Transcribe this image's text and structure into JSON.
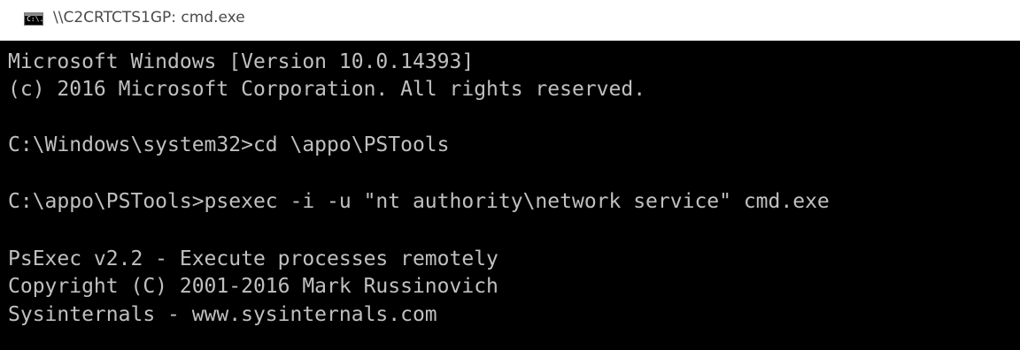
{
  "window": {
    "title": "\\\\C2CRTCTS1GP: cmd.exe",
    "icon": "cmd-icon",
    "icon_label": "C:\\."
  },
  "console": {
    "background": "#000000",
    "text_color": "#c0c0c0",
    "lines": [
      "Microsoft Windows [Version 10.0.14393]",
      "(c) 2016 Microsoft Corporation. All rights reserved.",
      "C:\\Windows\\system32>cd \\appo\\PSTools",
      "C:\\appo\\PSTools>psexec -i -u \"nt authority\\network service\" cmd.exe",
      "PsExec v2.2 - Execute processes remotely",
      "Copyright (C) 2001-2016 Mark Russinovich",
      "Sysinternals - www.sysinternals.com"
    ]
  }
}
